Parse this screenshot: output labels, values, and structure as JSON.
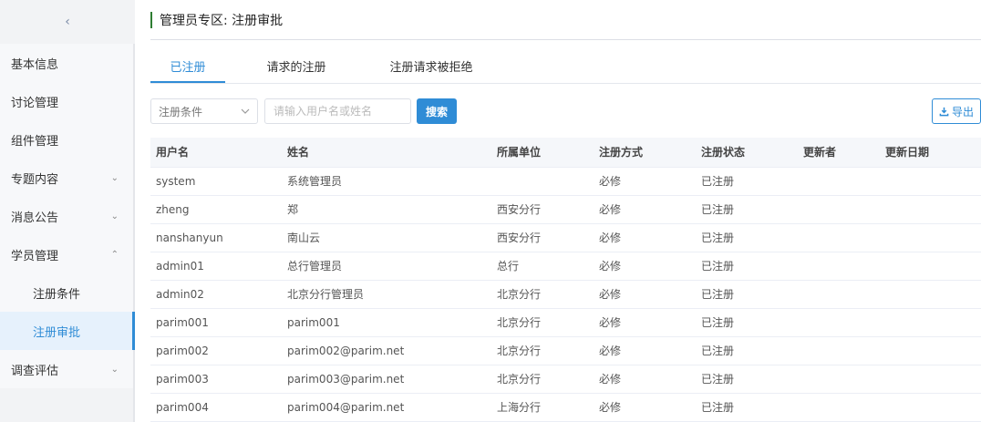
{
  "sidebar": {
    "collapse_glyph": "‹",
    "items": [
      {
        "label": "基本信息",
        "chevron": ""
      },
      {
        "label": "讨论管理",
        "chevron": ""
      },
      {
        "label": "组件管理",
        "chevron": ""
      },
      {
        "label": "专题内容",
        "chevron": "⌄"
      },
      {
        "label": "消息公告",
        "chevron": "⌄"
      },
      {
        "label": "学员管理",
        "chevron": "⌃"
      },
      {
        "label": "注册条件",
        "chevron": ""
      },
      {
        "label": "注册审批",
        "chevron": ""
      },
      {
        "label": "调查评估",
        "chevron": "⌄"
      }
    ],
    "active_color": "#2f8cd6"
  },
  "header": {
    "title": "管理员专区: 注册审批",
    "accent": "#2e7d32"
  },
  "tabs": [
    {
      "label": "已注册",
      "active": true
    },
    {
      "label": "请求的注册",
      "active": false
    },
    {
      "label": "注册请求被拒绝",
      "active": false
    }
  ],
  "toolbar": {
    "select_value": "注册条件",
    "search_placeholder": "请输入用户名或姓名",
    "search_label": "搜索",
    "export_label": "导出",
    "export_icon": "download-icon"
  },
  "table": {
    "columns": [
      "用户名",
      "姓名",
      "所属单位",
      "注册方式",
      "注册状态",
      "更新者",
      "更新日期"
    ],
    "rows": [
      [
        "system",
        "系统管理员",
        "",
        "必修",
        "已注册",
        "",
        ""
      ],
      [
        "zheng",
        "郑",
        "西安分行",
        "必修",
        "已注册",
        "",
        ""
      ],
      [
        "nanshanyun",
        "南山云",
        "西安分行",
        "必修",
        "已注册",
        "",
        ""
      ],
      [
        "admin01",
        "总行管理员",
        "总行",
        "必修",
        "已注册",
        "",
        ""
      ],
      [
        "admin02",
        "北京分行管理员",
        "北京分行",
        "必修",
        "已注册",
        "",
        ""
      ],
      [
        "parim001",
        "parim001",
        "北京分行",
        "必修",
        "已注册",
        "",
        ""
      ],
      [
        "parim002",
        "parim002@parim.net",
        "北京分行",
        "必修",
        "已注册",
        "",
        ""
      ],
      [
        "parim003",
        "parim003@parim.net",
        "北京分行",
        "必修",
        "已注册",
        "",
        ""
      ],
      [
        "parim004",
        "parim004@parim.net",
        "上海分行",
        "必修",
        "已注册",
        "",
        ""
      ]
    ]
  }
}
